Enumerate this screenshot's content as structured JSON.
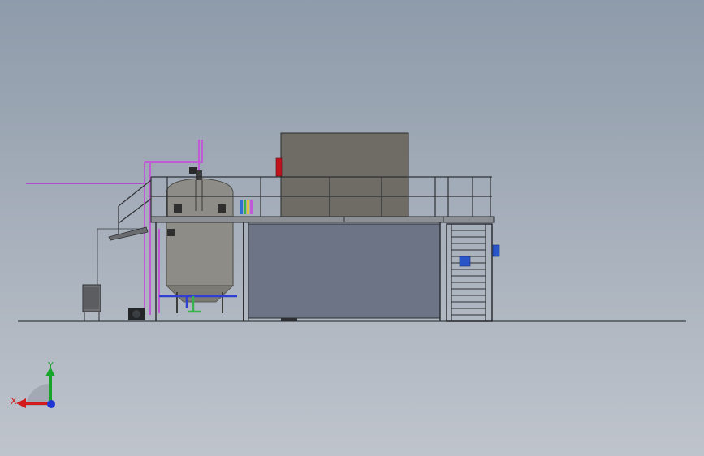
{
  "viewport": {
    "background_top": "#8e9baa",
    "background_bottom": "#bfc4cc"
  },
  "model": {
    "accent_colors": {
      "pipe_magenta": "#c05bd6",
      "pipe_blue": "#2f3fd0",
      "pipe_green": "#37b24d",
      "label_red": "#c0141c",
      "box_blue": "#2a55c8",
      "metal": "#7f8185",
      "tank": "#8d8c86",
      "enclosure": "#6f6c66",
      "panel": "#6c7486"
    },
    "icons": [
      "tank-icon",
      "platform-icon",
      "stair-icon",
      "handrail-icon"
    ]
  },
  "triad": {
    "x_label": "X",
    "y_label": "Y",
    "x_color": "#d21b1b",
    "y_color": "#16a52a",
    "z_color": "#1f35d4"
  }
}
